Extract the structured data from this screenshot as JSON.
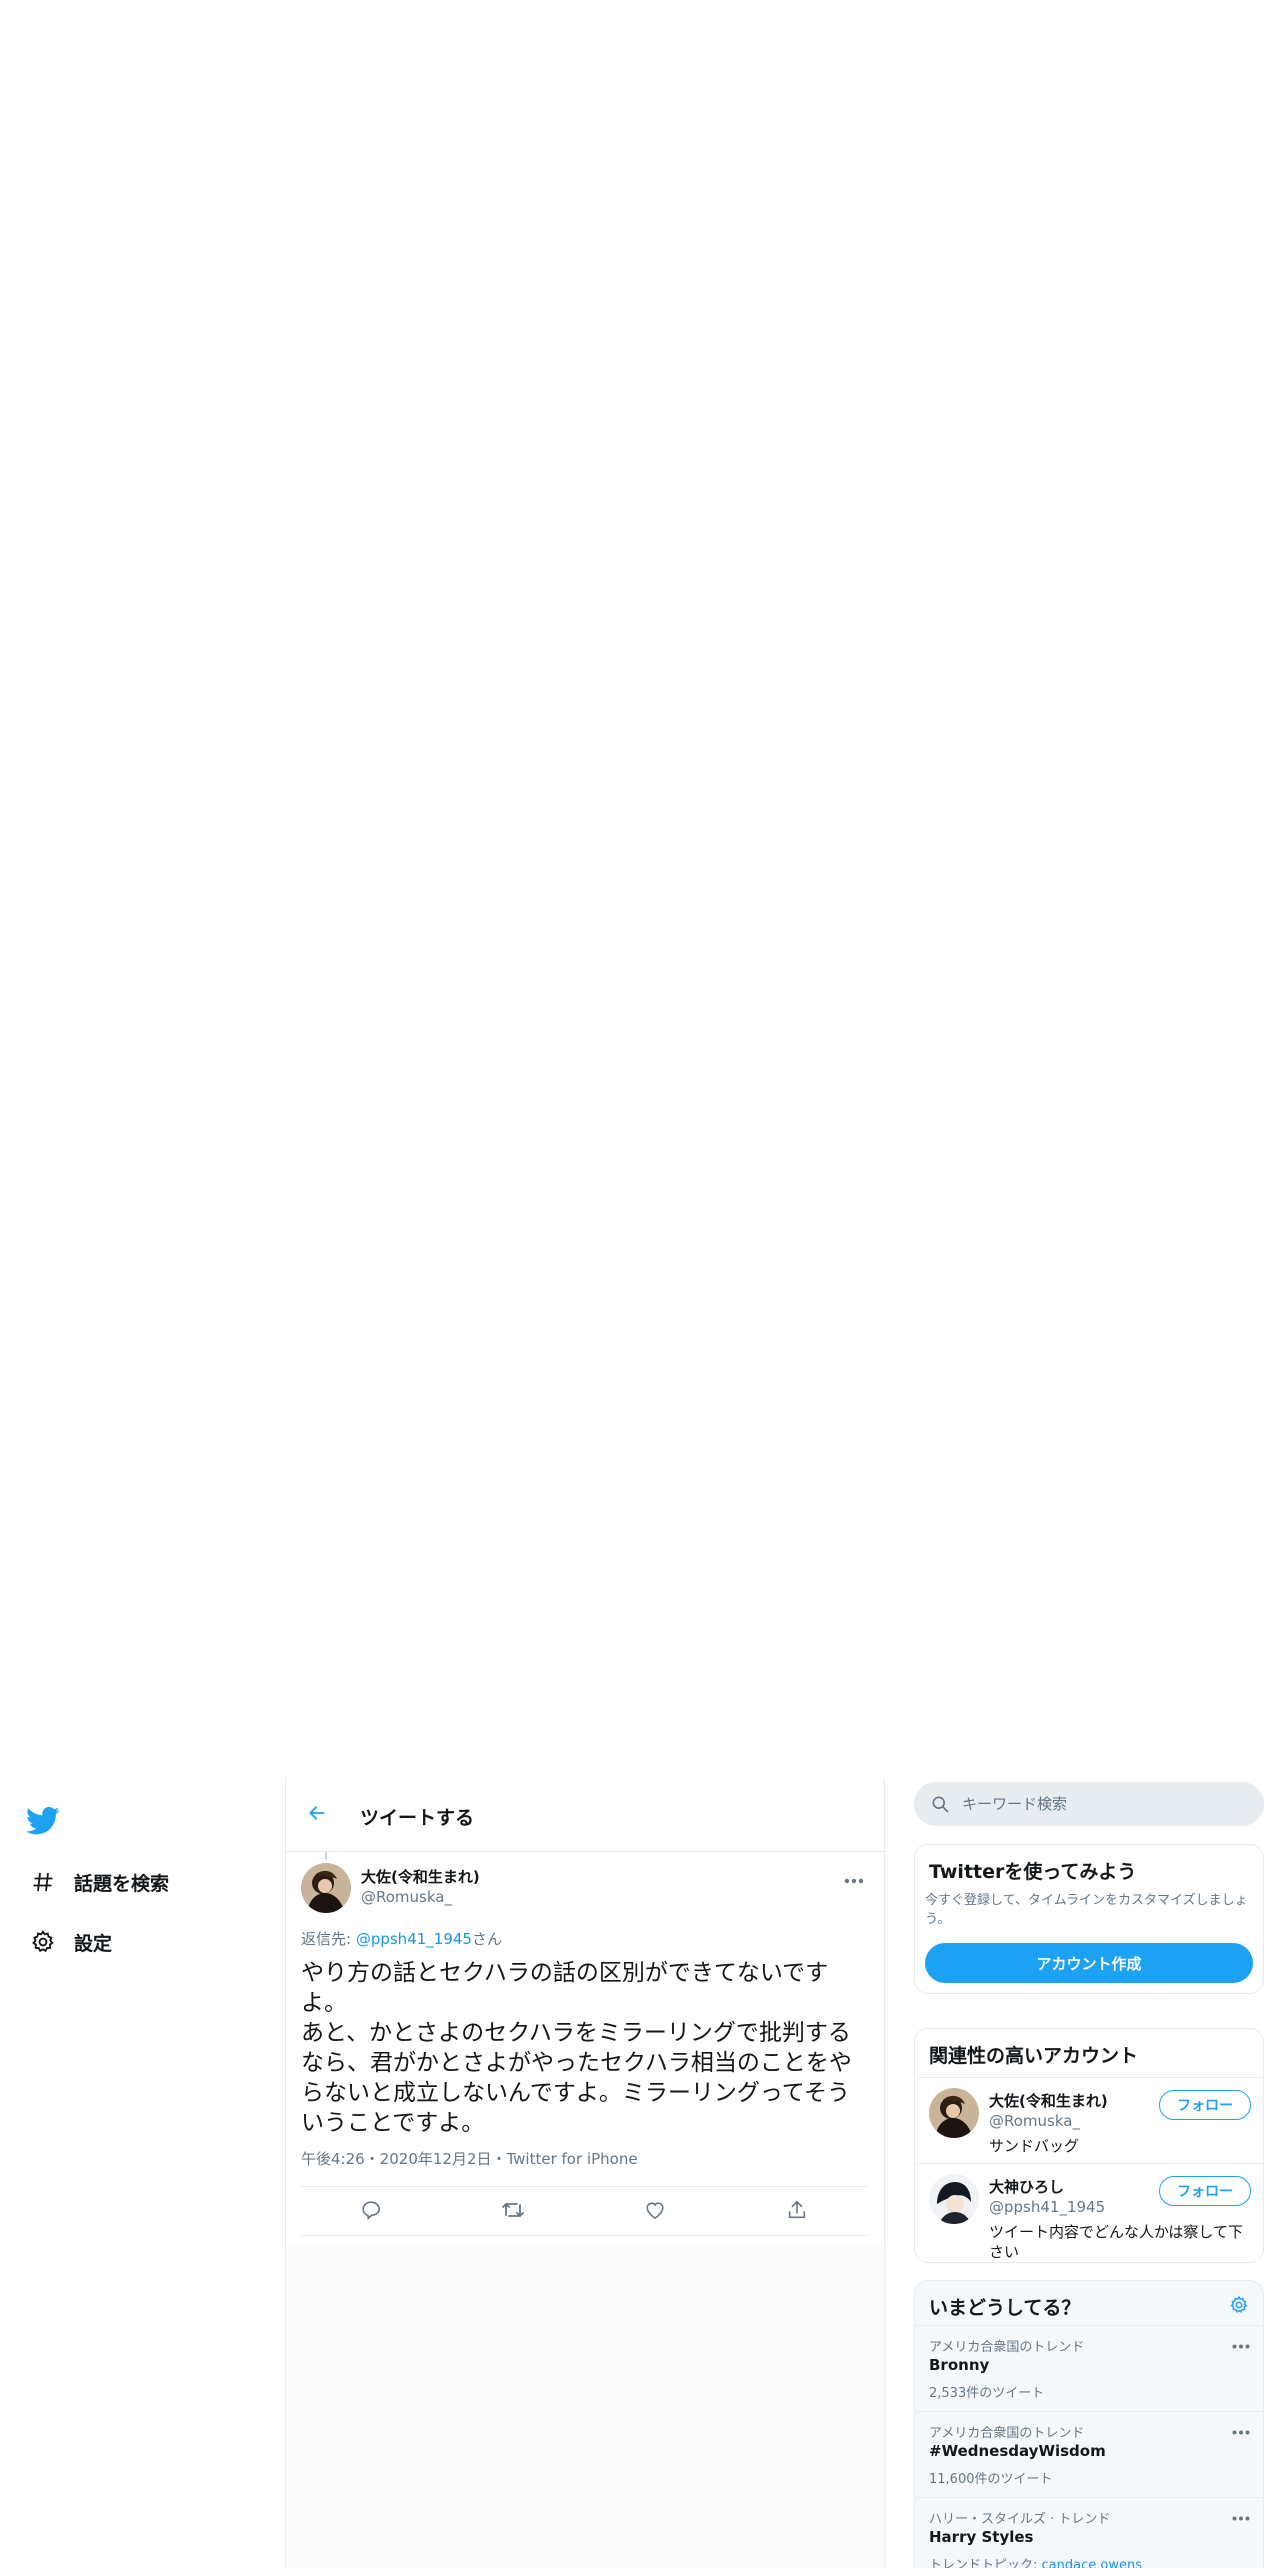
{
  "nav": {
    "logo_icon": "twitter-bird-icon",
    "items": [
      {
        "icon": "hashtag-icon",
        "label": "話題を検索"
      },
      {
        "icon": "gear-icon",
        "label": "設定"
      }
    ]
  },
  "header": {
    "back_icon": "arrow-left-icon",
    "title": "ツイートする"
  },
  "tweet": {
    "author_name": "大佐(令和生まれ)",
    "author_handle": "@Romuska_",
    "reply_prefix": "返信先: ",
    "reply_mention": "@ppsh41_1945",
    "reply_suffix": "さん",
    "text": "やり方の話とセクハラの話の区別ができてないですよ。\nあと、かとさよのセクハラをミラーリングで批判するなら、君がかとさよがやったセクハラ相当のことをやらないと成立しないんですよ。ミラーリングってそういうことですよ。",
    "meta": "午後4:26・2020年12月2日・Twitter for iPhone",
    "actions": [
      "reply-icon",
      "retweet-icon",
      "like-icon",
      "share-icon"
    ]
  },
  "search": {
    "placeholder": "キーワード検索"
  },
  "signup": {
    "title": "Twitterを使ってみよう",
    "description": "今すぐ登録して、タイムラインをカスタマイズしましょう。",
    "button": "アカウント作成"
  },
  "related": {
    "title": "関連性の高いアカウント",
    "accounts": [
      {
        "name": "大佐(令和生まれ)",
        "handle": "@Romuska_",
        "bio": "サンドバッグ",
        "follow": "フォロー"
      },
      {
        "name": "大神ひろし",
        "handle": "@ppsh41_1945",
        "bio": "ツイート内容でどんな人かは察して下さい",
        "follow": "フォロー"
      }
    ]
  },
  "trends": {
    "title": "いまどうしてる？",
    "items": [
      {
        "meta": "アメリカ合衆国のトレンド",
        "name": "Bronny",
        "count": "2,533件のツイート"
      },
      {
        "meta": "アメリカ合衆国のトレンド",
        "name": "#WednesdayWisdom",
        "count": "11,600件のツイート"
      },
      {
        "meta": "ハリー・スタイルズ · トレンド",
        "name": "Harry Styles",
        "count_prefix": "トレンドトピック: ",
        "count_link": "candace owens"
      }
    ]
  },
  "colors": {
    "accent": "#1da1f2",
    "link": "#1b95e0",
    "secondary_text": "#657786",
    "border": "#e6ecf0"
  }
}
